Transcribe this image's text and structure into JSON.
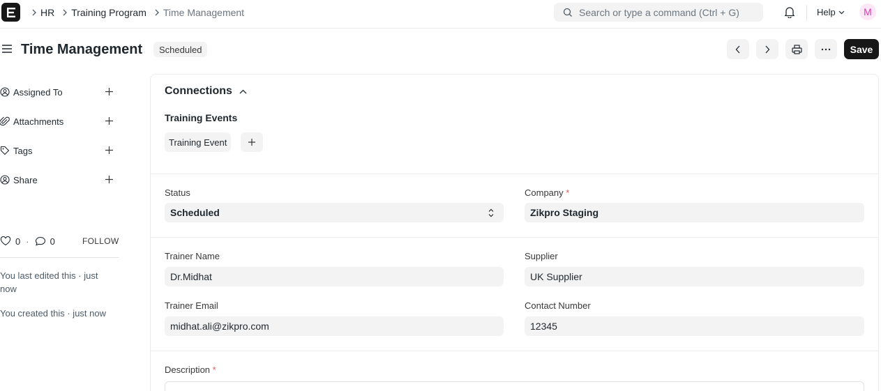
{
  "navbar": {
    "logo_letter": "E",
    "breadcrumbs": [
      "HR",
      "Training Program",
      "Time Management"
    ],
    "search_placeholder": "Search or type a command (Ctrl + G)",
    "help_label": "Help",
    "avatar_initial": "M"
  },
  "page": {
    "title": "Time Management",
    "status": "Scheduled",
    "save_label": "Save"
  },
  "sidebar": {
    "items": [
      {
        "label": "Assigned To",
        "icon": "assign-user-icon"
      },
      {
        "label": "Attachments",
        "icon": "paperclip-icon"
      },
      {
        "label": "Tags",
        "icon": "tag-icon"
      },
      {
        "label": "Share",
        "icon": "share-user-icon"
      }
    ],
    "likes": "0",
    "comments": "0",
    "follow_label": "FOLLOW",
    "activity": [
      "You last edited this · just now",
      "You created this · just now"
    ]
  },
  "connections": {
    "title": "Connections",
    "group_title": "Training Events",
    "chip_label": "Training Event"
  },
  "form": {
    "status": {
      "label": "Status",
      "value": "Scheduled"
    },
    "company": {
      "label": "Company",
      "required_mark": "*",
      "value": "Zikpro Staging"
    },
    "trainer_name": {
      "label": "Trainer Name",
      "value": "Dr.Midhat"
    },
    "supplier": {
      "label": "Supplier",
      "value": "UK Supplier"
    },
    "trainer_email": {
      "label": "Trainer Email",
      "value": "midhat.ali@zikpro.com"
    },
    "contact_number": {
      "label": "Contact Number",
      "value": "12345"
    },
    "description": {
      "label": "Description",
      "required_mark": "*"
    }
  },
  "colors": {
    "primary_button": "#171717",
    "required": "#e25a5a",
    "avatar_bg": "#fce7f6",
    "avatar_fg": "#d63bb0"
  }
}
